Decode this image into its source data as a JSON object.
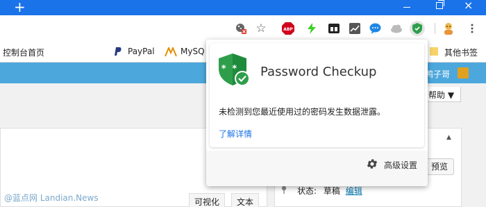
{
  "colors": {
    "titlebar": "#1a73e8",
    "adminbar": "#4ca8dc",
    "link": "#1a73e8",
    "shield_green": "#2e9e4b"
  },
  "window_controls": {
    "new_tab_icon": "+",
    "close_icon": "×"
  },
  "toolbar": {
    "icons": [
      "cookie-blocked-icon",
      "bookmark-star-icon",
      "adblock-plus-icon",
      "bolt-icon",
      "tab-extension-icon",
      "chart-extension-icon",
      "chat-extension-icon",
      "weather-cloud-icon",
      "password-checkup-icon",
      "profile-avatar-icon",
      "menu-kebab-icon"
    ],
    "abp_label": "ABP"
  },
  "bookmarks": {
    "dashboard_home": "控制台首页",
    "paypal": "PayPal",
    "mysql": "MySQ",
    "other": "其他书签"
  },
  "adminbar": {
    "user_name": "鸭子哥"
  },
  "page": {
    "help_label": "帮助 ▼",
    "preview_label": "预览",
    "status_label": "状态:",
    "status_value": "草稿",
    "status_edit": "编辑",
    "editor_tabs": [
      "可视化",
      "文本"
    ],
    "side_arrow": "▲",
    "watermark": "@蓝点网 Landian.News"
  },
  "popup": {
    "title": "Password Checkup",
    "message": "未检测到您最近使用过的密码发生数据泄露。",
    "learn_more": "了解详情",
    "advanced_settings": "高级设置",
    "shield_text": "* *"
  }
}
